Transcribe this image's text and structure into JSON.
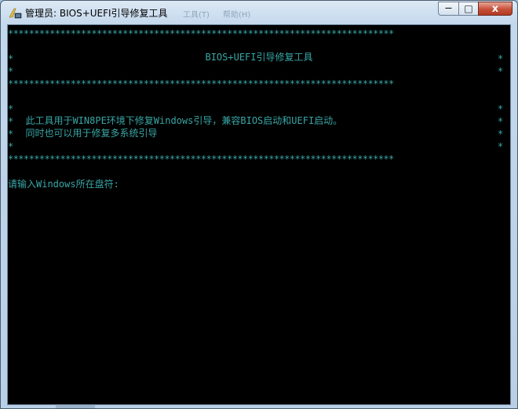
{
  "window": {
    "title": "管理员:  BIOS+UEFI引导修复工具",
    "ghost_text_1": "工具(T)",
    "ghost_text_2": "帮助(H)",
    "controls": {
      "minimize": "—",
      "maximize": "□",
      "close": "x"
    }
  },
  "console": {
    "border_stars": "**************************************************************************",
    "star": "*",
    "header_title": "BIOS+UEFI引导修复工具",
    "desc_line_1": "  此工具用于WIN8PE环境下修复Windows引导，兼容BIOS启动和UEFI启动。",
    "desc_line_2": "  同时也可以用于修复多系统引导",
    "prompt": "请输入Windows所在盘符:"
  },
  "colors": {
    "console_background": "#000000",
    "console_text": "#3aa6a6",
    "titlebar": "#c4d8ec"
  }
}
